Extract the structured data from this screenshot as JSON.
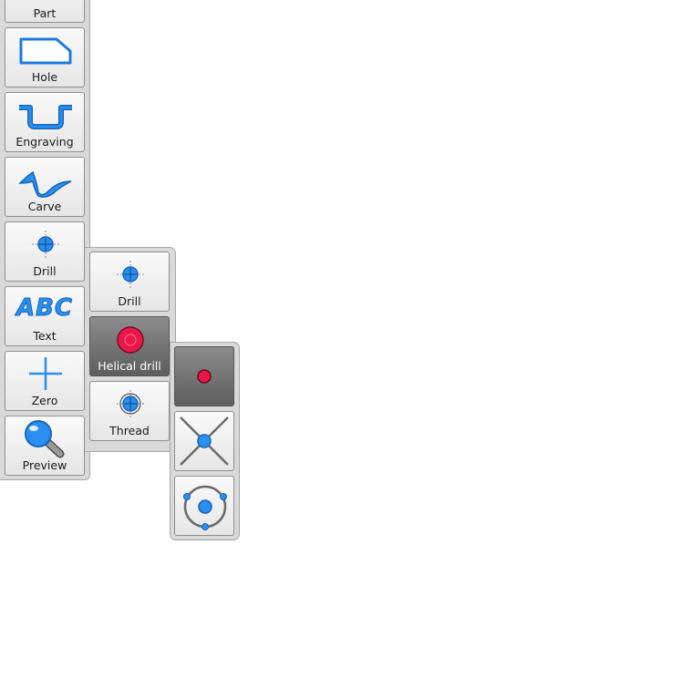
{
  "main_toolbar": {
    "items": [
      {
        "label": "Part",
        "icon": "part-icon"
      },
      {
        "label": "Hole",
        "icon": "hole-icon"
      },
      {
        "label": "Engraving",
        "icon": "engraving-icon"
      },
      {
        "label": "Carve",
        "icon": "carve-icon"
      },
      {
        "label": "Drill",
        "icon": "drill-icon"
      },
      {
        "label": "Text",
        "icon": "text-abc-icon"
      },
      {
        "label": "Zero",
        "icon": "zero-crosshair-icon"
      },
      {
        "label": "Preview",
        "icon": "magnifier-icon"
      }
    ],
    "text_icon_glyph": "ABC"
  },
  "drill_submenu": {
    "items": [
      {
        "label": "Drill",
        "icon": "drill-icon",
        "selected": false
      },
      {
        "label": "Helical drill",
        "icon": "helical-drill-icon",
        "selected": true
      },
      {
        "label": "Thread",
        "icon": "thread-icon",
        "selected": false
      }
    ]
  },
  "position_submenu": {
    "items": [
      {
        "icon": "single-point-icon",
        "selected": true
      },
      {
        "icon": "cross-center-icon",
        "selected": false
      },
      {
        "icon": "circle-center-icon",
        "selected": false
      }
    ]
  },
  "colors": {
    "accent_blue": "#2a8ff0",
    "icon_outline": "#1565b8",
    "active_red": "#e8194a",
    "panel_bg": "#d9d9d9",
    "active_bg": "#6e6e6e"
  }
}
